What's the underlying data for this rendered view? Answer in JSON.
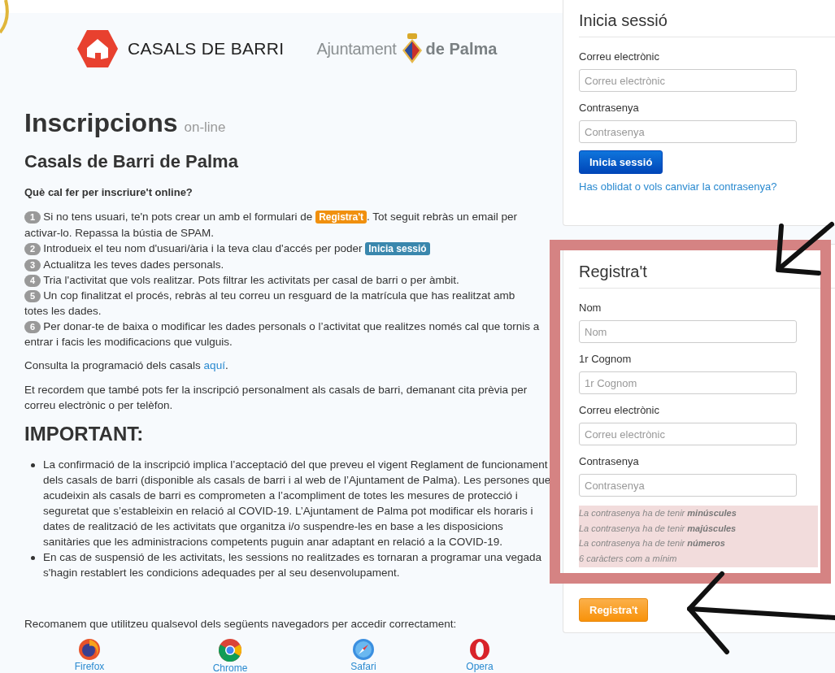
{
  "header": {
    "brand": "CASALS DE BARRI",
    "city_prefix": "Ajuntament",
    "city_name": "de Palma"
  },
  "intro": {
    "title": "Inscripcions",
    "title_suffix": "on-line",
    "subtitle": "Casals de Barri de Palma",
    "question": "Què cal fer per inscriure't online?",
    "steps": [
      {
        "number": "1",
        "before": "Si no tens usuari, te'n pots crear un amb el formulari de ",
        "badge": {
          "text": "Registra't",
          "color": "#f0900f"
        },
        "after": ". Tot seguit rebràs un email per activar-lo. Repassa la bústia de SPAM."
      },
      {
        "number": "2",
        "before": "Introdueix el teu nom d'usuari/ària i la teva clau d'accés per poder ",
        "badge": {
          "text": "Inicia sessió",
          "color": "#3a87ad"
        }
      },
      {
        "number": "3",
        "before": "Actualitza les teves dades personals."
      },
      {
        "number": "4",
        "before": "Tria l'activitat que vols realitzar. Pots filtrar les activitats per casal de barri o per àmbit."
      },
      {
        "number": "5",
        "before": "Un cop finalitzat el procés, rebràs al teu correu un resguard de la matrícula que has realitzat amb totes les dades."
      },
      {
        "number": "6",
        "before": "Per donar-te de baixa o modificar les dades personals o l’activitat que realitzes només cal que tornis a entrar i facis les modificacions que vulguis."
      }
    ],
    "consult": {
      "text": "Consulta la programació dels casals ",
      "link": "aquí",
      "after": "."
    },
    "note": "Et recordem que també pots fer la inscripció personalment als casals de barri, demanant cita prèvia per correu electrònic o per telèfon."
  },
  "important": {
    "title": "IMPORTANT:",
    "bullets": [
      "La confirmació de la inscripció implica l’acceptació del que preveu el vigent Reglament de funcionament dels casals de barri (disponible als casals de barri i al web de l’Ajuntament de Palma). Les persones que acudeixin als casals de barri es comprometen a l’acompliment de totes les mesures de protecció i seguretat que s’estableixin en relació al COVID-19. L’Ajuntament de Palma pot modificar els horaris i dates de realització de les activitats que organitza i/o suspendre-les en base a les disposicions sanitàries que les administracions competents puguin anar adaptant en relació a la COVID-19.",
      "En cas de suspensió de les activitats, les sessions no realitzades es tornaran a programar una vegada s'hagin restablert les condicions adequades per al seu desenvolupament."
    ]
  },
  "browsers": {
    "prompt": "Recomanem que utilitzeu qualsevol dels següents navegadors per accedir correctament:",
    "items": [
      {
        "name": "Firefox",
        "kind": "firefox"
      },
      {
        "name": "Chrome",
        "kind": "chrome"
      },
      {
        "name": "Safari",
        "kind": "safari"
      },
      {
        "name": "Opera",
        "kind": "opera"
      }
    ]
  },
  "login": {
    "title": "Inicia sessió",
    "fields": [
      {
        "label": "Correu electrònic",
        "placeholder": "Correu electrònic"
      },
      {
        "label": "Contrasenya",
        "placeholder": "Contrasenya"
      }
    ],
    "button": "Inicia sessió",
    "forgot_link": "Has oblidat o vols canviar la contrasenya?"
  },
  "register": {
    "title": "Registra't",
    "fields": [
      {
        "label": "Nom",
        "placeholder": "Nom"
      },
      {
        "label": "1r Cognom",
        "placeholder": "1r Cognom"
      },
      {
        "label": "Correu electrònic",
        "placeholder": "Correu electrònic"
      },
      {
        "label": "Contrasenya",
        "placeholder": "Contrasenya"
      }
    ],
    "rules": [
      "La contrasenya ha de tenir **minúscules**",
      "La contrasenya ha de tenir **majúscules**",
      "La contrasenya ha de tenir **números**",
      "6 caràcters com a mínim"
    ],
    "button": "Registra't"
  }
}
